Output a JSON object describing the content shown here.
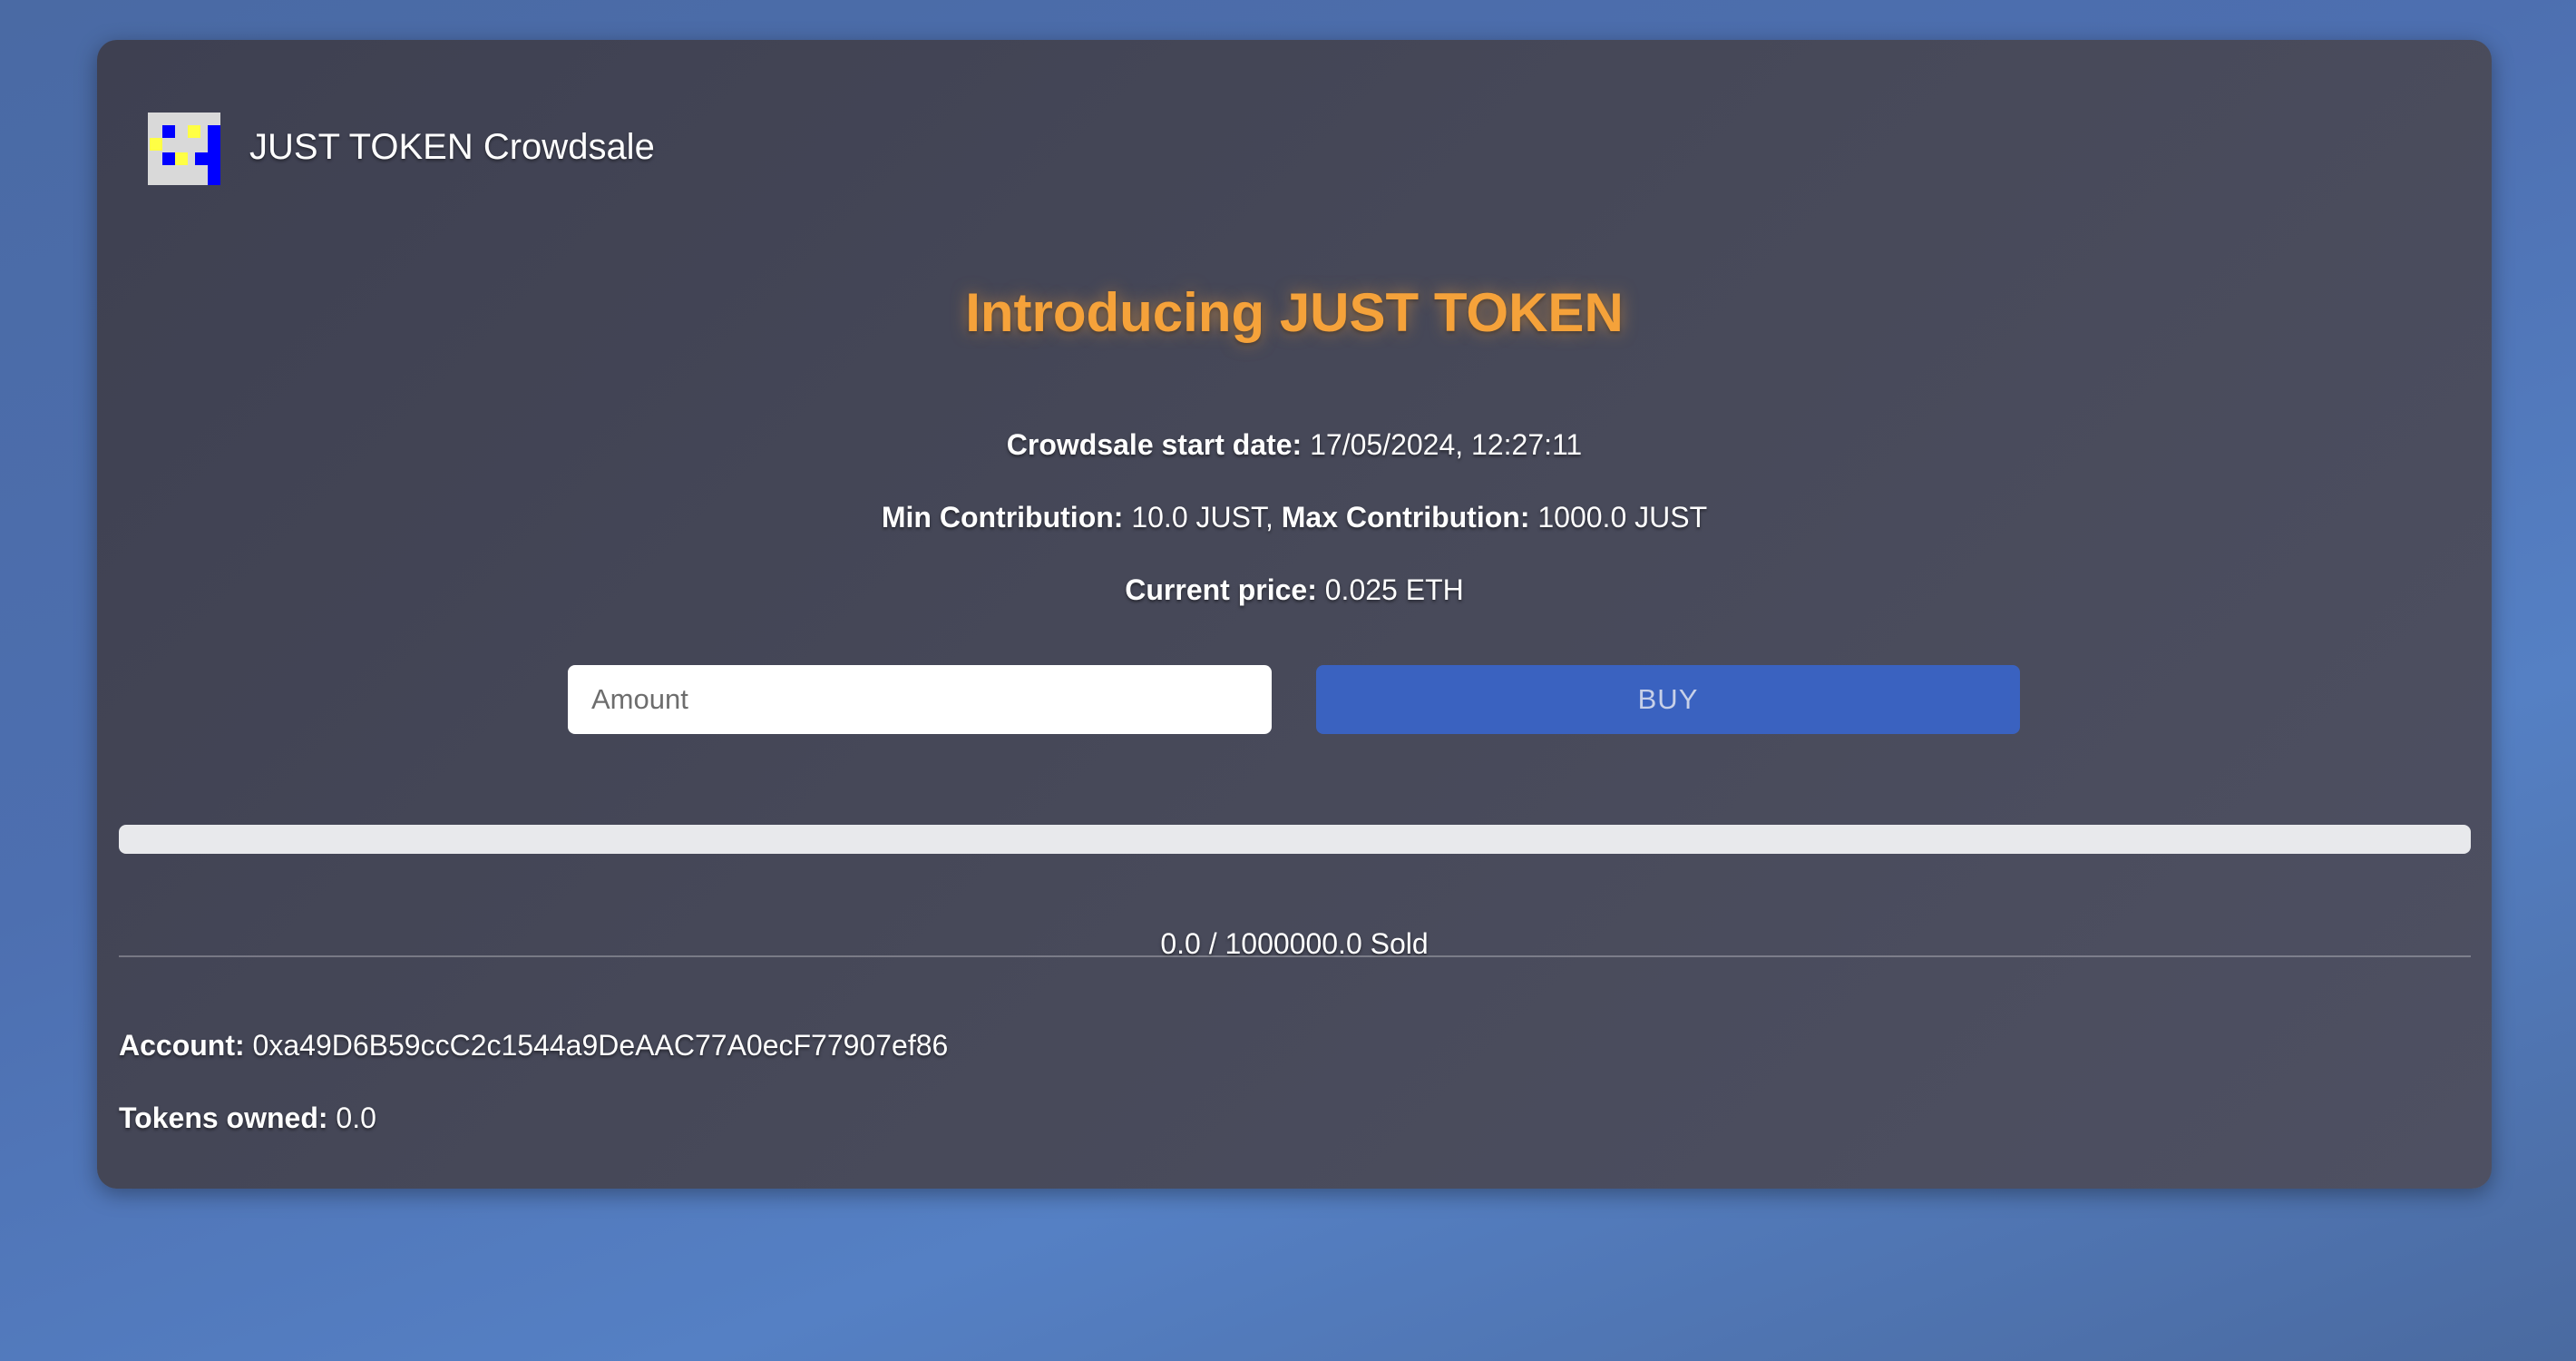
{
  "header": {
    "brand": "JUST TOKEN Crowdsale",
    "logo_icon": "pixel-logo-icon"
  },
  "hero": {
    "title": "Introducing JUST TOKEN"
  },
  "details": {
    "start_label": "Crowdsale start date:",
    "start_value": "17/05/2024, 12:27:11",
    "min_label": "Min Contribution:",
    "min_value": "10.0 JUST,",
    "max_label": "Max Contribution:",
    "max_value": "1000.0 JUST",
    "price_label": "Current price:",
    "price_value": "0.025 ETH"
  },
  "purchase": {
    "amount_placeholder": "Amount",
    "amount_value": "",
    "buy_label": "BUY"
  },
  "progress": {
    "fraction": 0.0,
    "sold_text": "0.0 / 1000000.0 Sold"
  },
  "account": {
    "account_label": "Account:",
    "account_value": "0xa49D6B59ccC2c1544a9DeAAC77A0ecF77907ef86",
    "tokens_label": "Tokens owned:",
    "tokens_value": "0.0"
  },
  "colors": {
    "accent": "#3a62c0",
    "headline": "#f5a23a",
    "card": "#45475a",
    "background": "#4d6fb0"
  }
}
